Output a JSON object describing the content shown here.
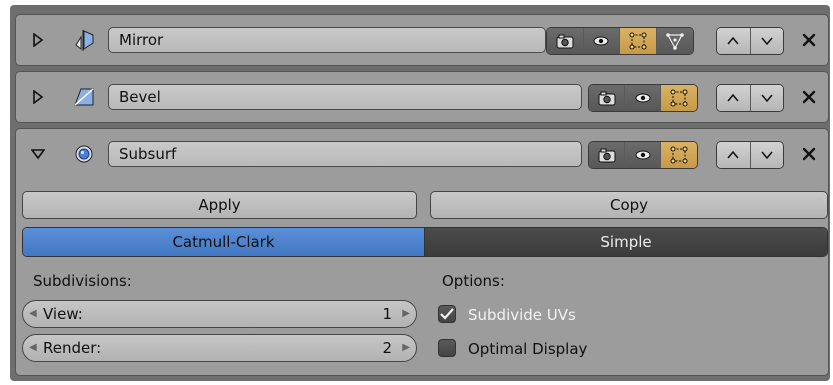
{
  "modifiers": [
    {
      "name": "Mirror",
      "type_icon": "mirror-icon",
      "expanded": false,
      "buttons": [
        "render-camera-icon",
        "eye-icon",
        "edit-mode-icon",
        "cage-vertex-icon"
      ]
    },
    {
      "name": "Bevel",
      "type_icon": "bevel-icon",
      "expanded": false,
      "buttons": [
        "render-camera-icon",
        "eye-icon",
        "edit-mode-icon"
      ]
    },
    {
      "name": "Subsurf",
      "type_icon": "subsurf-icon",
      "expanded": true,
      "buttons": [
        "render-camera-icon",
        "eye-icon",
        "edit-mode-icon"
      ]
    }
  ],
  "subsurf": {
    "apply_label": "Apply",
    "copy_label": "Copy",
    "algorithm": {
      "options": [
        "Catmull-Clark",
        "Simple"
      ],
      "selected": "Catmull-Clark"
    },
    "subdivisions_heading": "Subdivisions:",
    "view_label": "View:",
    "view_value": "1",
    "render_label": "Render:",
    "render_value": "2",
    "options_heading": "Options:",
    "subdivide_uvs_label": "Subdivide UVs",
    "subdivide_uvs_checked": true,
    "optimal_display_label": "Optimal Display",
    "optimal_display_checked": false
  },
  "colors": {
    "selected_tab": "#4a7fcc",
    "panel_bg": "#9c9c9c",
    "frame_bg": "#6e6e6e"
  }
}
